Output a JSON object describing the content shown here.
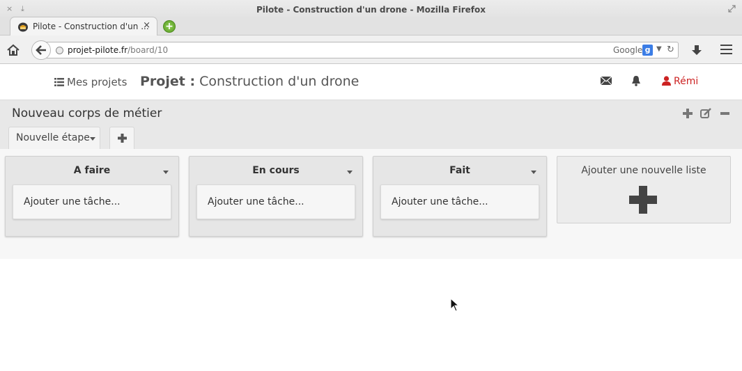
{
  "window": {
    "title": "Pilote - Construction d'un drone - Mozilla Firefox",
    "close_glyph": "×",
    "download_glyph": "⤓"
  },
  "browser": {
    "tab_title": "Pilote - Construction d'un ...",
    "tab_close": "×",
    "new_tab": "+",
    "url_host": "projet-pilote.fr",
    "url_path": "/board/10",
    "search_engine": "Google",
    "search_badge": "g",
    "search_dropdown": "▼",
    "reload_glyph": "↻"
  },
  "header": {
    "my_projects": "Mes projets",
    "project_label": "Projet :",
    "project_name": "Construction d'un drone",
    "user_name": "Rémi"
  },
  "board": {
    "title": "Nouveau corps de métier",
    "stage_tab": "Nouvelle étape",
    "lists": [
      {
        "title": "A faire",
        "add_task": "Ajouter une tâche..."
      },
      {
        "title": "En cours",
        "add_task": "Ajouter une tâche..."
      },
      {
        "title": "Fait",
        "add_task": "Ajouter une tâche..."
      }
    ],
    "new_list_label": "Ajouter une nouvelle liste"
  },
  "colors": {
    "user_accent": "#cc2222",
    "board_header_bg": "#e8e8e8",
    "list_bg": "#e6e6e6"
  },
  "icons": [
    "home-icon",
    "back-arrow-icon",
    "globe-icon",
    "download-icon",
    "hamburger-menu-icon",
    "list-icon",
    "mail-icon",
    "bell-icon",
    "user-icon",
    "plus-icon",
    "edit-icon",
    "minus-icon",
    "caret-down-icon"
  ]
}
